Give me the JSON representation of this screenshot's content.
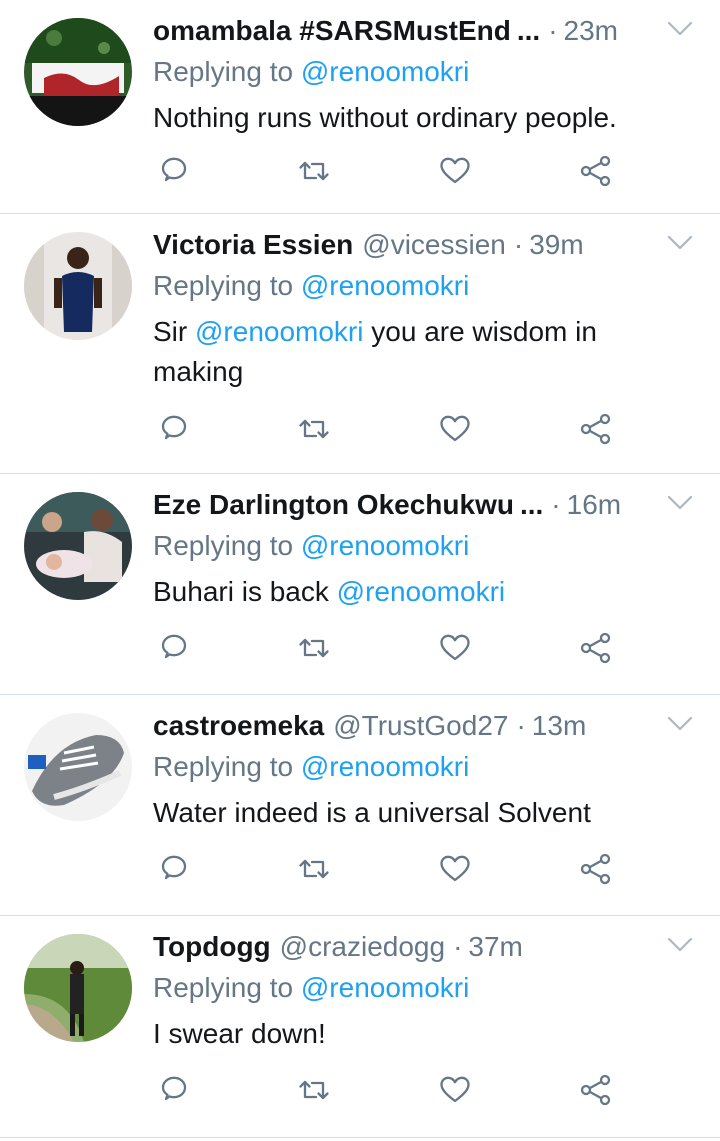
{
  "reply_prefix": "Replying to",
  "tweets": [
    {
      "name": "omambala #SARSMustEnd",
      "handle": "",
      "truncated": "...",
      "time": "23m",
      "replying_to": "@renoomokri",
      "text_before": "Nothing runs without ordinary people.",
      "text_mention": "",
      "text_after": ""
    },
    {
      "name": "Victoria Essien",
      "handle": "@vicessien",
      "truncated": "",
      "time": "39m",
      "replying_to": "@renoomokri",
      "text_before": "Sir ",
      "text_mention": "@renoomokri",
      "text_after": " you are wisdom in making"
    },
    {
      "name": "Eze Darlington Okechukwu",
      "handle": "",
      "truncated": "...",
      "time": "16m",
      "replying_to": "@renoomokri",
      "text_before": "Buhari is back ",
      "text_mention": "@renoomokri",
      "text_after": ""
    },
    {
      "name": "castroemeka",
      "handle": "@TrustGod27",
      "truncated": "",
      "time": "13m",
      "replying_to": "@renoomokri",
      "text_before": "Water indeed is a universal Solvent",
      "text_mention": "",
      "text_after": ""
    },
    {
      "name": "Topdogg",
      "handle": "@craziedogg",
      "truncated": "",
      "time": "37m",
      "replying_to": "@renoomokri",
      "text_before": "I swear down!",
      "text_mention": "",
      "text_after": ""
    }
  ],
  "icons": {
    "reply": "reply-icon",
    "retweet": "retweet-icon",
    "like": "heart-icon",
    "share": "share-icon",
    "caret": "chevron-down-icon"
  },
  "colors": {
    "name": "#14171a",
    "meta": "#657786",
    "mention": "#1da1f2",
    "divider": "#d9dee3"
  }
}
